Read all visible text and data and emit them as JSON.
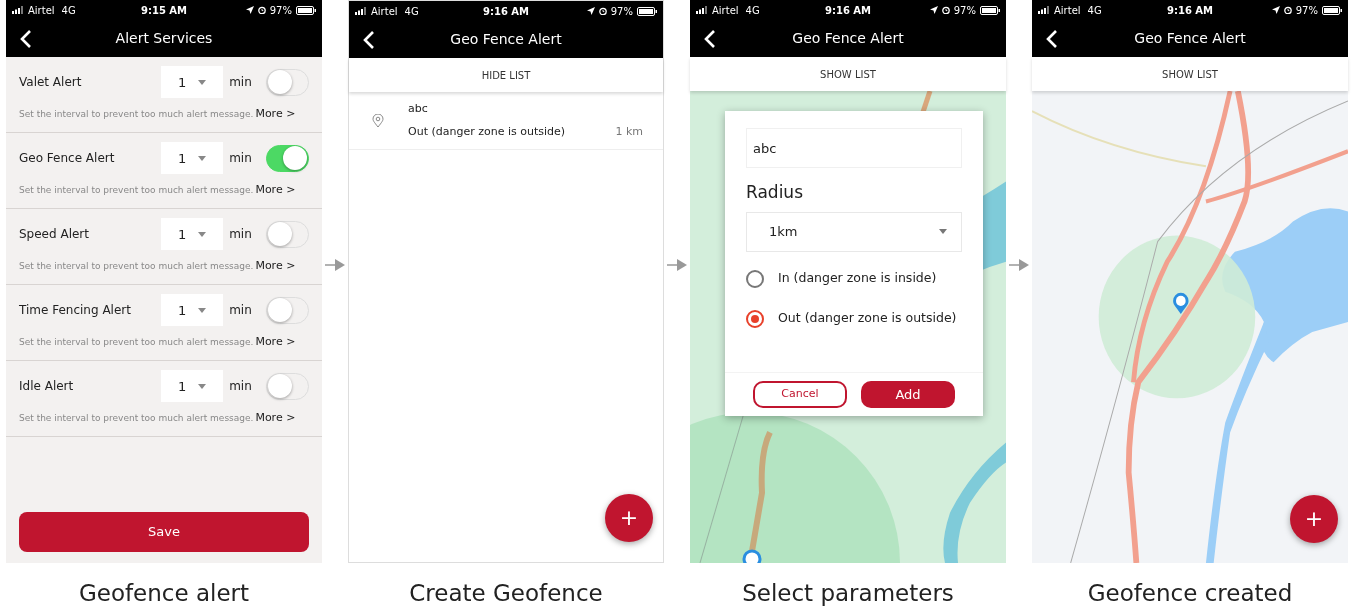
{
  "screens": [
    {
      "kind": "alert_list",
      "status_bar": {
        "carrier": "Airtel",
        "network": "4G",
        "time": "9:15 AM",
        "battery": "97%"
      },
      "title": "Alert Services",
      "alerts": [
        {
          "name": "Valet Alert",
          "interval": "1",
          "unit": "min",
          "on": false,
          "hint": "Set the interval to prevent too much alert message.",
          "more": "More >"
        },
        {
          "name": "Geo Fence Alert",
          "interval": "1",
          "unit": "min",
          "on": true,
          "hint": "Set the interval to prevent too much alert message.",
          "more": "More >"
        },
        {
          "name": "Speed Alert",
          "interval": "1",
          "unit": "min",
          "on": false,
          "hint": "Set the interval to prevent too much alert message.",
          "more": "More >"
        },
        {
          "name": "Time Fencing Alert",
          "interval": "1",
          "unit": "min",
          "on": false,
          "hint": "Set the interval to prevent too much alert message.",
          "more": "More >"
        },
        {
          "name": "Idle Alert",
          "interval": "1",
          "unit": "min",
          "on": false,
          "hint": "Set the interval to prevent too much alert message.",
          "more": "More >"
        }
      ],
      "save_button": "Save",
      "caption": "Geofence alert"
    },
    {
      "kind": "fence_list",
      "status_bar": {
        "carrier": "Airtel",
        "network": "4G",
        "time": "9:16 AM",
        "battery": "97%"
      },
      "title": "Geo Fence Alert",
      "list_toggle": "HIDE LIST",
      "fences": [
        {
          "name": "abc",
          "mode": "Out (danger zone is outside)",
          "radius": "1 km"
        }
      ],
      "fab": "+",
      "caption": "Create Geofence"
    },
    {
      "kind": "fence_dialog",
      "status_bar": {
        "carrier": "Airtel",
        "network": "4G",
        "time": "9:16 AM",
        "battery": "97%"
      },
      "title": "Geo Fence Alert",
      "list_toggle": "SHOW LIST",
      "dialog": {
        "name_value": "abc",
        "radius_label": "Radius",
        "radius_value": "1km",
        "options": [
          {
            "label": "In (danger zone is inside)",
            "selected": false
          },
          {
            "label": "Out (danger zone is outside)",
            "selected": true
          }
        ],
        "cancel": "Cancel",
        "add": "Add"
      },
      "caption": "Select parameters"
    },
    {
      "kind": "fence_map",
      "status_bar": {
        "carrier": "Airtel",
        "network": "4G",
        "time": "9:16 AM",
        "battery": "97%"
      },
      "title": "Geo Fence Alert",
      "list_toggle": "SHOW LIST",
      "fab": "+",
      "caption": "Geofence created"
    }
  ]
}
